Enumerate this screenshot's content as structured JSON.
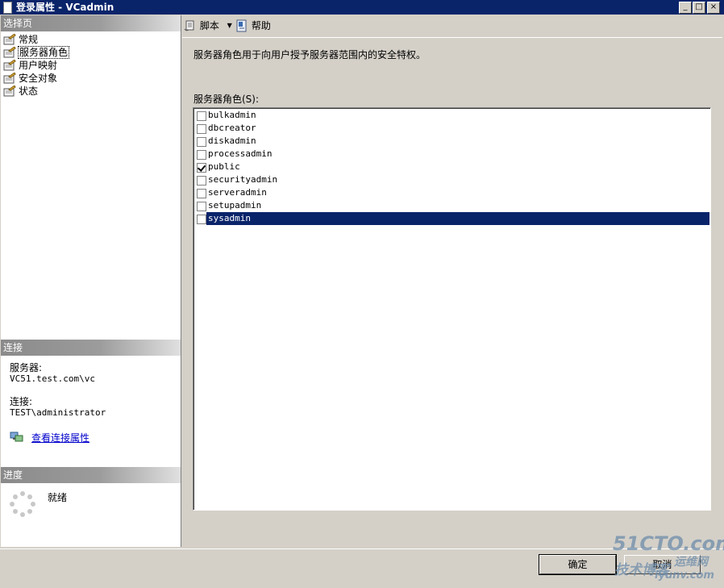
{
  "window": {
    "title": "登录属性 - VCadmin",
    "minimize": "_",
    "maximize": "□",
    "close": "×"
  },
  "left": {
    "select_page_header": "选择页",
    "pages": [
      {
        "label": "常规"
      },
      {
        "label": "服务器角色"
      },
      {
        "label": "用户映射"
      },
      {
        "label": "安全对象"
      },
      {
        "label": "状态"
      }
    ],
    "selected_page": "服务器角色",
    "connection": {
      "header": "连接",
      "server_label": "服务器:",
      "server_value": "VC51.test.com\\vc",
      "conn_label": "连接:",
      "conn_value": "TEST\\administrator",
      "view_props_link": "查看连接属性"
    },
    "progress": {
      "header": "进度",
      "status": "就绪"
    }
  },
  "toolbar": {
    "script_label": "脚本",
    "help_label": "帮助"
  },
  "main": {
    "description": "服务器角色用于向用户授予服务器范围内的安全特权。",
    "list_label": "服务器角色(S):",
    "roles": [
      {
        "name": "bulkadmin",
        "checked": false
      },
      {
        "name": "dbcreator",
        "checked": false
      },
      {
        "name": "diskadmin",
        "checked": false
      },
      {
        "name": "processadmin",
        "checked": false
      },
      {
        "name": "public",
        "checked": true
      },
      {
        "name": "securityadmin",
        "checked": false
      },
      {
        "name": "serveradmin",
        "checked": false
      },
      {
        "name": "setupadmin",
        "checked": false
      },
      {
        "name": "sysadmin",
        "checked": false
      }
    ],
    "selected_role": "sysadmin"
  },
  "buttons": {
    "ok": "确定",
    "cancel": "取消"
  },
  "watermark": {
    "line1": "51CTO.com",
    "line2": "技术博客",
    "line3": "运维网",
    "line4": "iyunv.com"
  },
  "colors": {
    "title_bar": "#0a246a",
    "selection": "#0a246a",
    "dialog_bg": "#d4d0c8"
  }
}
